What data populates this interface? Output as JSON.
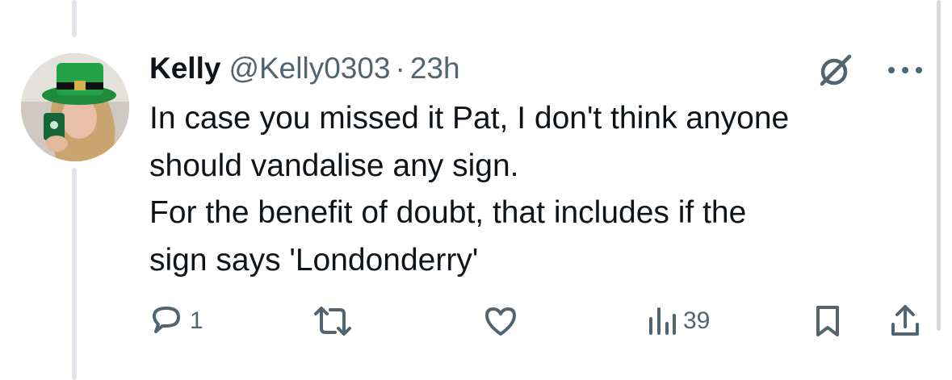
{
  "post": {
    "author_name": "Kelly",
    "handle": "@Kelly0303",
    "separator": "·",
    "time": "23h",
    "text_lines": [
      "In case you missed it Pat, I don't think anyone",
      "should vandalise any sign.",
      "For the benefit of doubt, that includes if the",
      "sign says 'Londonderry'"
    ]
  },
  "actions": {
    "reply_count": "1",
    "repost_count": "",
    "like_count": "",
    "views_count": "39"
  },
  "icons": {
    "avatar": "avatar",
    "grok": "grok-icon",
    "more": "more-icon",
    "reply": "reply-icon",
    "repost": "repost-icon",
    "like": "heart-icon",
    "views": "views-icon",
    "bookmark": "bookmark-icon",
    "share": "share-icon"
  },
  "colors": {
    "text": "#0f1419",
    "secondary": "#536471",
    "thread_line": "#e1e4e8"
  }
}
